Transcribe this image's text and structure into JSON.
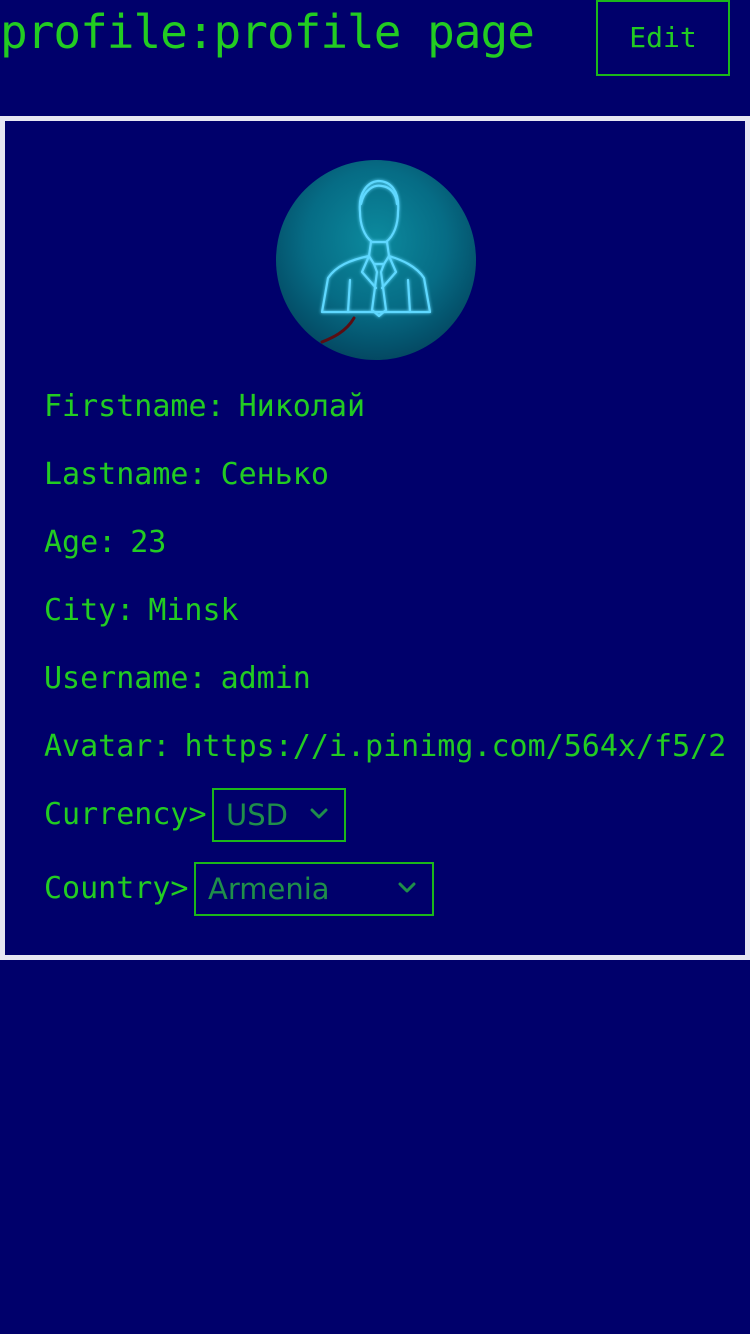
{
  "header": {
    "title": "profile:profile page",
    "edit_label": "Edit"
  },
  "profile": {
    "avatar_icon": "businessman-avatar-icon",
    "fields": [
      {
        "label": "Firstname:",
        "value": "Николай"
      },
      {
        "label": "Lastname:",
        "value": "Сенько"
      },
      {
        "label": "Age:",
        "value": "23"
      },
      {
        "label": "City:",
        "value": "Minsk"
      },
      {
        "label": "Username:",
        "value": "admin"
      },
      {
        "label": "Avatar:",
        "value": "https://i.pinimg.com/564x/f5/2"
      }
    ],
    "currency": {
      "label": "Currency>",
      "value": "USD"
    },
    "country": {
      "label": "Country>",
      "value": "Armenia"
    }
  },
  "colors": {
    "background": "#00006b",
    "text": "#22cc22",
    "border": "#e6e6f2"
  }
}
